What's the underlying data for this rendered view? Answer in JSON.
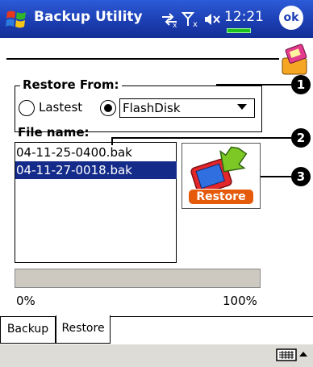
{
  "titlebar": {
    "title": "Backup Utility",
    "time": "12:21",
    "ok_label": "ok"
  },
  "restore_from": {
    "label": "Restore From:",
    "options": [
      {
        "label": "Lastest",
        "selected": false
      },
      {
        "label": "",
        "selected": true
      }
    ],
    "dropdown_value": "FlashDisk"
  },
  "files": {
    "label": "File name:",
    "items": [
      {
        "name": "04-11-25-0400.bak",
        "selected": false
      },
      {
        "name": "04-11-27-0018.bak",
        "selected": true
      }
    ]
  },
  "restore_button": {
    "label": "Restore"
  },
  "callouts": [
    "1",
    "2",
    "3"
  ],
  "progress": {
    "value": 0,
    "min_label": "0%",
    "max_label": "100%"
  },
  "tabs": [
    {
      "label": "Backup",
      "active": false
    },
    {
      "label": "Restore",
      "active": true
    }
  ],
  "colors": {
    "titlebar": "#1c3fb4",
    "selection": "#142b8a",
    "restore_orange": "#e55a0b",
    "progress_track": "#cdc9c1",
    "bottombar": "#dedcd7"
  }
}
